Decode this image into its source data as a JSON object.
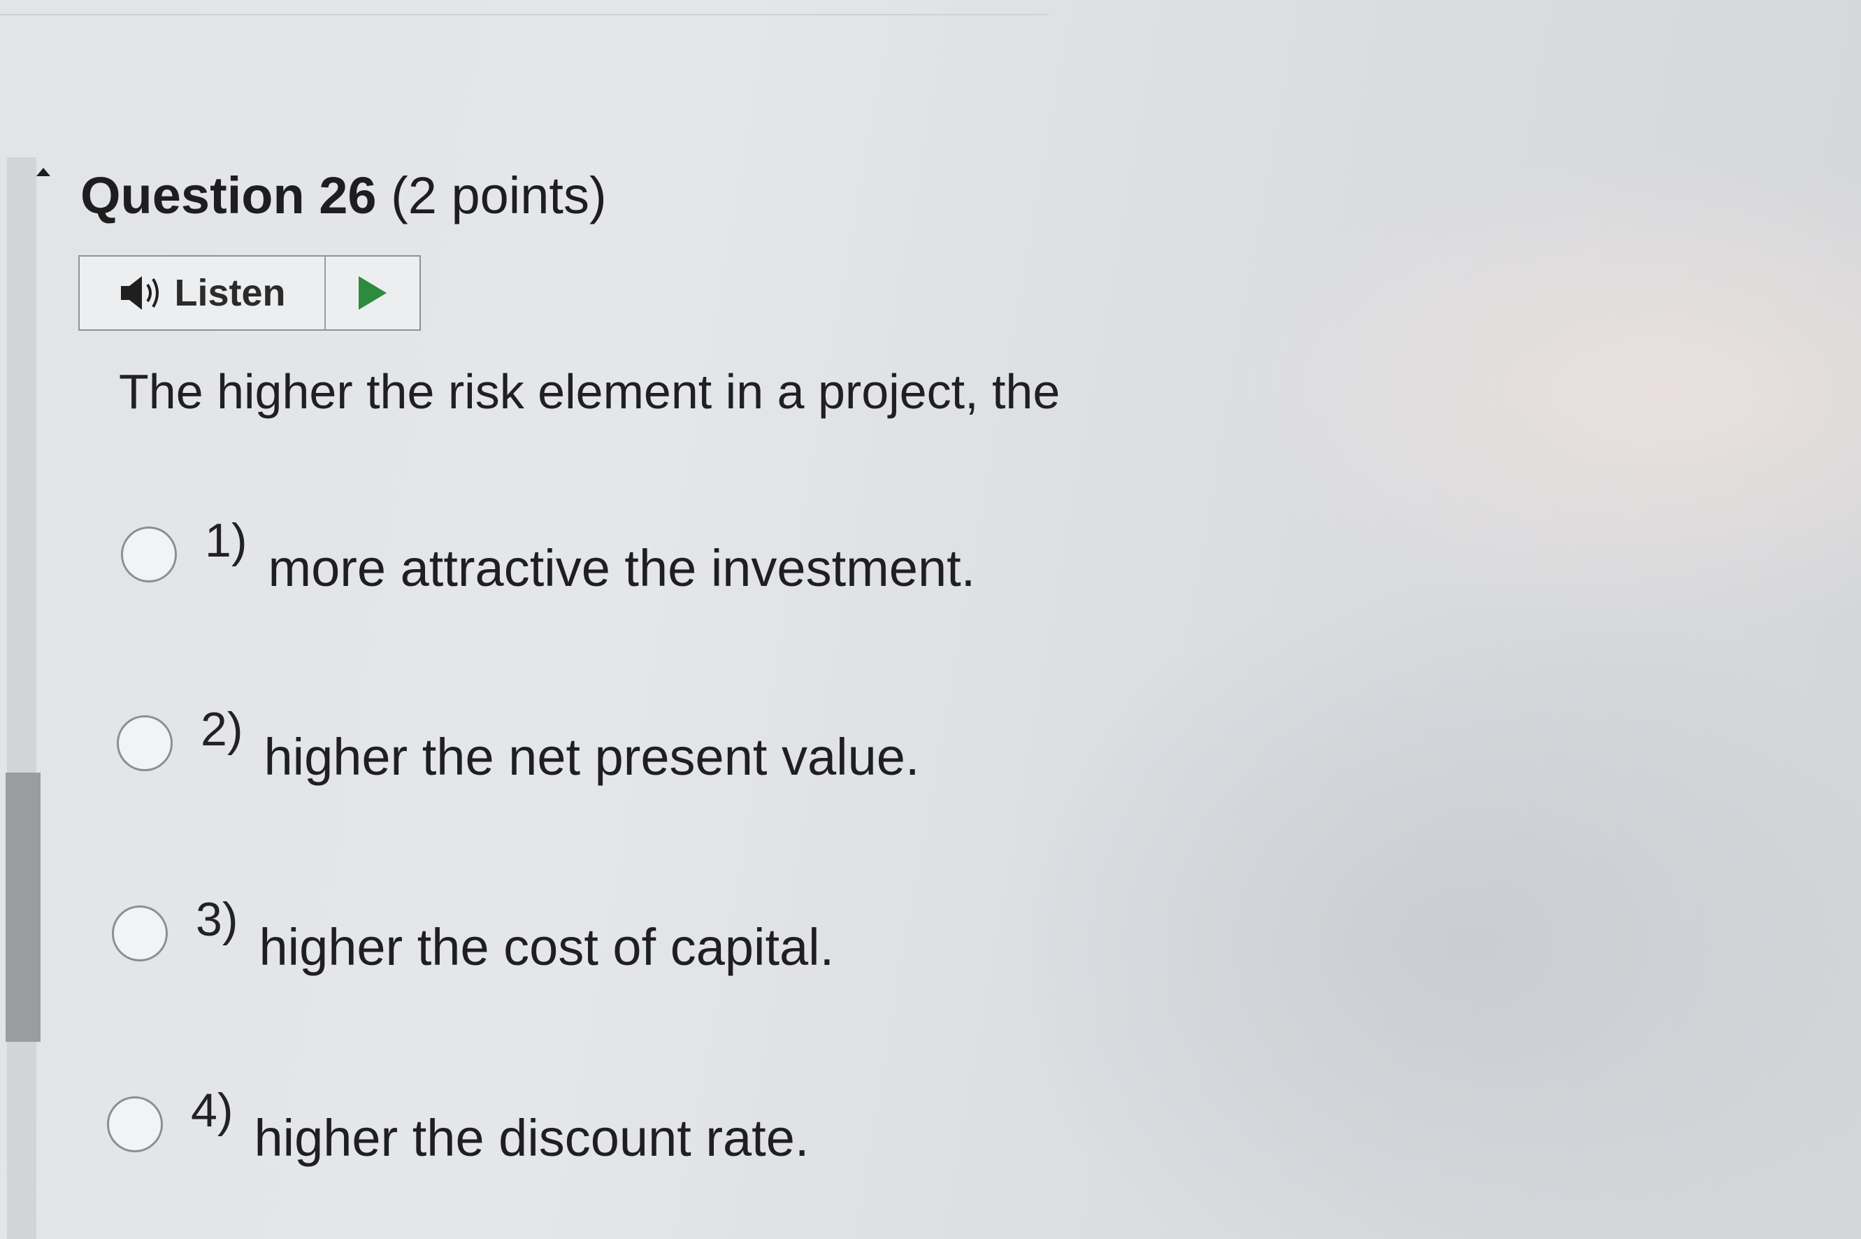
{
  "question": {
    "number_label": "Question 26",
    "points_label": "(2 points)",
    "text": "The higher the risk element in a project, the"
  },
  "listen": {
    "label": "Listen",
    "speaker_icon": "speaker-icon",
    "play_icon": "play-icon",
    "play_color": "#2e8a3e"
  },
  "options": [
    {
      "number": "1)",
      "text": "more attractive the investment."
    },
    {
      "number": "2)",
      "text": "higher the net present value."
    },
    {
      "number": "3)",
      "text": "higher the cost of capital."
    },
    {
      "number": "4)",
      "text": "higher the discount rate."
    }
  ]
}
